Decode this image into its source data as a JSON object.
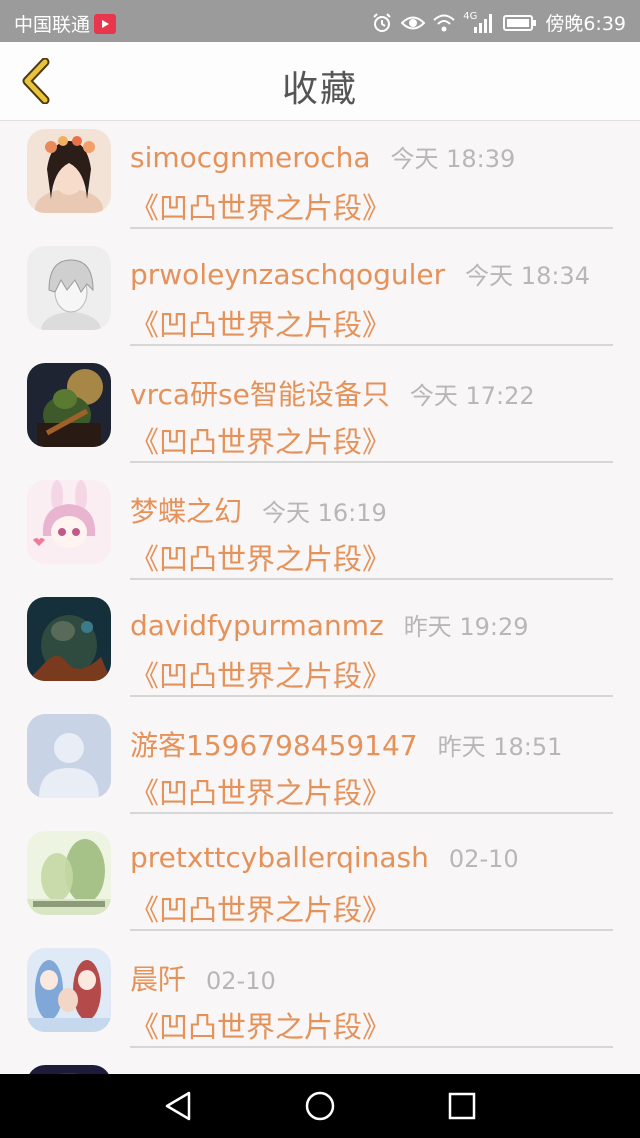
{
  "status_bar": {
    "carrier": "中国联通",
    "network": "4G",
    "time": "傍晚6:39",
    "icons": [
      "alarm-icon",
      "eye-icon",
      "wifi-icon",
      "signal-icon",
      "battery-icon"
    ]
  },
  "header": {
    "title": "收藏",
    "back_icon": "chevron-left-icon"
  },
  "items": [
    {
      "name": "simocgnmerocha",
      "time": "今天 18:39",
      "subtitle": "《凹凸世界之片段》"
    },
    {
      "name": "prwoleynzaschqoguler",
      "time": "今天 18:34",
      "subtitle": "《凹凸世界之片段》"
    },
    {
      "name": "vrca研se智能设备只",
      "time": "今天 17:22",
      "subtitle": "《凹凸世界之片段》"
    },
    {
      "name": "梦蝶之幻",
      "time": "今天 16:19",
      "subtitle": "《凹凸世界之片段》"
    },
    {
      "name": "davidfypurmanmz",
      "time": "昨天 19:29",
      "subtitle": "《凹凸世界之片段》"
    },
    {
      "name": "游客1596798459147",
      "time": "昨天 18:51",
      "subtitle": "《凹凸世界之片段》"
    },
    {
      "name": "pretxttcyballerqinash",
      "time": "02-10",
      "subtitle": "《凹凸世界之片段》"
    },
    {
      "name": "晨阡",
      "time": "02-10",
      "subtitle": "《凹凸世界之片段》"
    }
  ],
  "nav_bar": {
    "buttons": [
      "back-triangle-icon",
      "home-circle-icon",
      "recents-square-icon"
    ]
  },
  "colors": {
    "accent": "#e5925a",
    "time_text": "#b7b7b7",
    "status_bar_bg": "#9b9b9b",
    "back_arrow": "#e9c33c"
  }
}
